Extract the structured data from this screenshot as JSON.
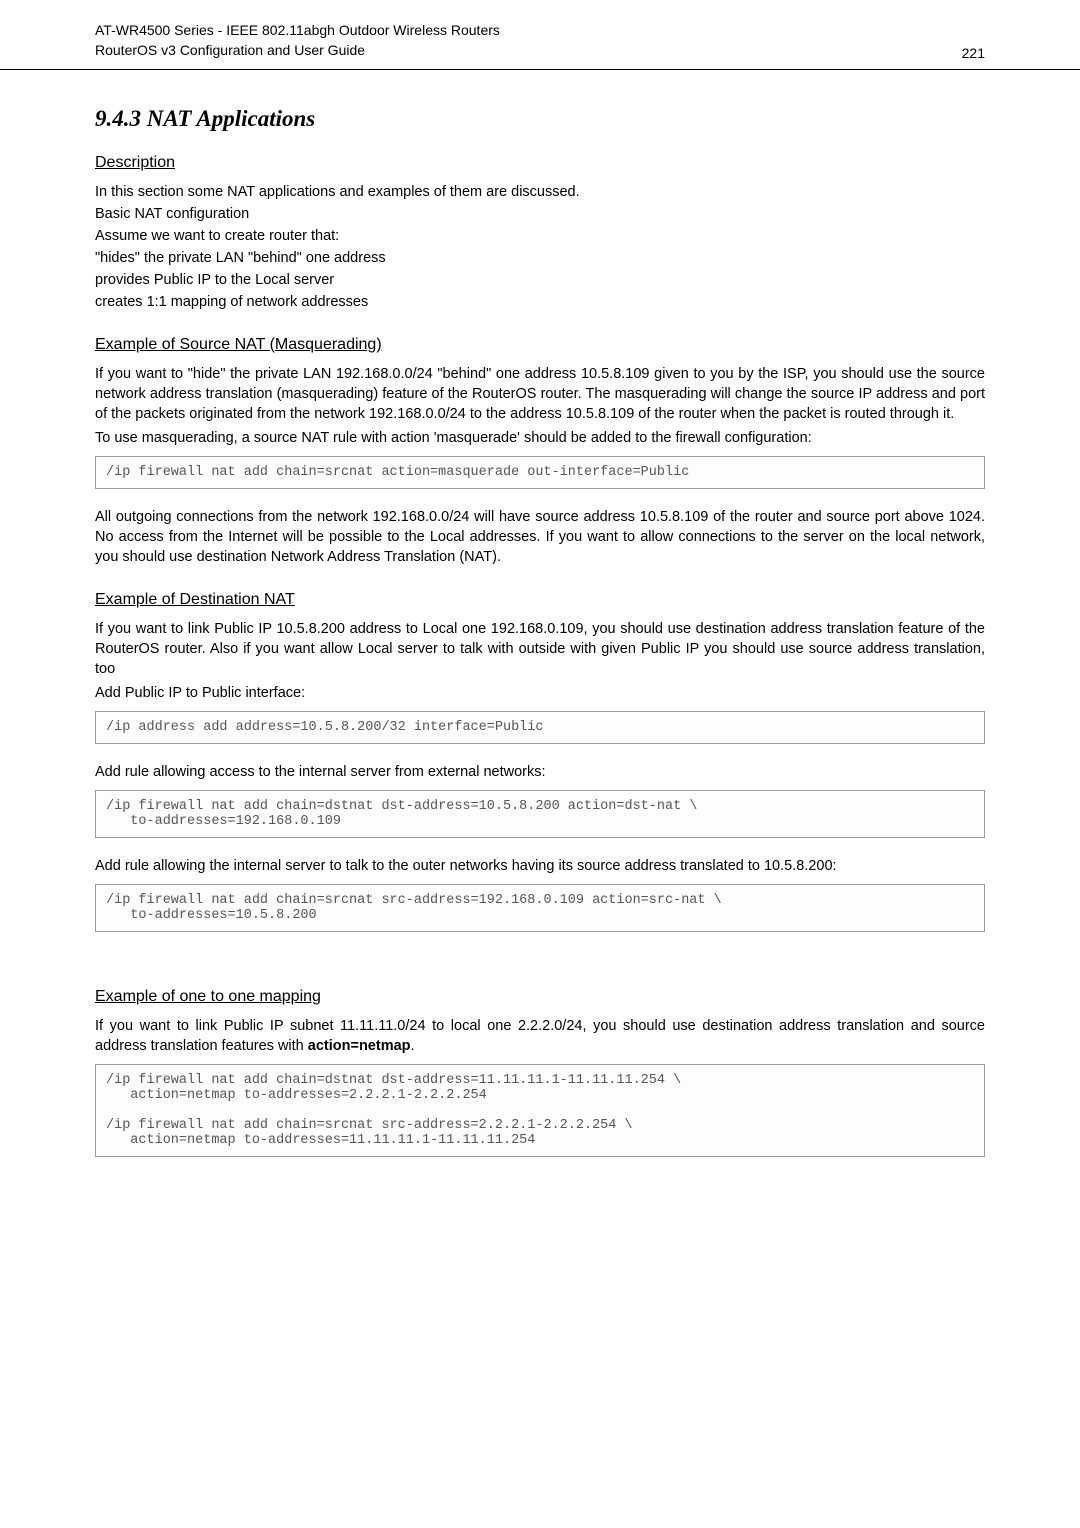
{
  "header": {
    "line1": "AT-WR4500 Series - IEEE 802.11abgh Outdoor Wireless Routers",
    "line2": "RouterOS v3 Configuration and User Guide",
    "pagenum": "221"
  },
  "section_title": "9.4.3  NAT Applications",
  "h_description": "Description",
  "desc_l1": "In this section some NAT applications and examples of them are discussed.",
  "desc_l2": "Basic NAT configuration",
  "desc_l3": "Assume we want to create router that:",
  "desc_l4": "\"hides\" the private LAN \"behind\" one address",
  "desc_l5": "provides Public IP to the Local server",
  "desc_l6": "creates 1:1 mapping of network addresses",
  "h_srcnat": "Example of Source NAT (Masquerading)",
  "srcnat_p1": "If you want to \"hide\" the private LAN 192.168.0.0/24 \"behind\" one address 10.5.8.109 given to you by the ISP, you should use the source network address translation (masquerading) feature of the RouterOS router. The masquerading will change the source IP address and port of the packets originated from the network 192.168.0.0/24 to the address 10.5.8.109 of the router when the packet is routed through it.",
  "srcnat_p2": "To use masquerading, a source NAT rule with action 'masquerade' should be added to the firewall configuration:",
  "code1": "/ip firewall nat add chain=srcnat action=masquerade out-interface=Public",
  "srcnat_p3": "All outgoing connections from the network 192.168.0.0/24 will have source address 10.5.8.109 of the router and source port above 1024. No access from the Internet will be possible to the Local addresses. If you want to allow connections to the server on the local network, you should use destination Network Address Translation (NAT).",
  "h_dstnat": "Example of Destination NAT",
  "dstnat_p1": "If you want to link Public IP 10.5.8.200 address to Local one 192.168.0.109, you should use destination address translation feature of the RouterOS router. Also if you want allow Local server to talk with outside with given Public IP you should use source address translation, too",
  "dstnat_p2": "Add Public IP to Public interface:",
  "code2": "/ip address add address=10.5.8.200/32 interface=Public",
  "dstnat_p3": "Add rule allowing access to the internal server from external networks:",
  "code3": "/ip firewall nat add chain=dstnat dst-address=10.5.8.200 action=dst-nat \\\n   to-addresses=192.168.0.109",
  "dstnat_p4": "Add rule allowing the internal server to talk to the outer networks having its source address translated to 10.5.8.200:",
  "code4": "/ip firewall nat add chain=srcnat src-address=192.168.0.109 action=src-nat \\\n   to-addresses=10.5.8.200",
  "h_oneone": "Example of one to one mapping",
  "oneone_p1_prefix": "If you want to link Public IP subnet 11.11.11.0/24 to local one 2.2.2.0/24, you should use destination address translation and source address translation features with ",
  "oneone_bold": "action=netmap",
  "oneone_p1_suffix": ".",
  "code5": "/ip firewall nat add chain=dstnat dst-address=11.11.11.1-11.11.11.254 \\\n   action=netmap to-addresses=2.2.2.1-2.2.2.254\n\n/ip firewall nat add chain=srcnat src-address=2.2.2.1-2.2.2.254 \\\n   action=netmap to-addresses=11.11.11.1-11.11.11.254"
}
